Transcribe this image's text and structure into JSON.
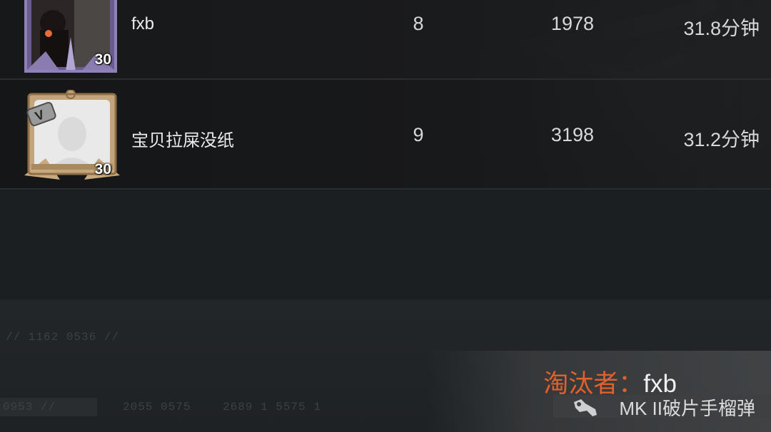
{
  "players": [
    {
      "name": "fxb",
      "level": "30",
      "kills": "8",
      "score": "1978",
      "time": "31.8分钟"
    },
    {
      "name": "宝贝拉屎没纸",
      "level": "30",
      "kills": "9",
      "score": "3198",
      "time": "31.2分钟"
    }
  ],
  "faint_codes": {
    "line1": "// 1162  0536 //",
    "line2": "0953 //",
    "line3": "2055 0575",
    "line4": "2689    1 5575 1"
  },
  "killer": {
    "label": "淘汰者：",
    "name": "fxb",
    "weapon": "MK II破片手榴弹",
    "weapon_icon": "grenade-icon"
  },
  "colors": {
    "accent": "#e2612a"
  }
}
